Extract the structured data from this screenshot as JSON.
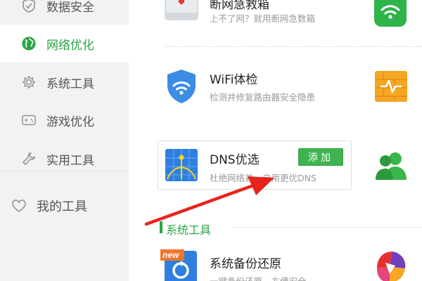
{
  "sidebar": {
    "items": [
      {
        "label": "数据安全",
        "icon": "shield-icon"
      },
      {
        "label": "网络优化",
        "icon": "globe-icon",
        "active": true
      },
      {
        "label": "系统工具",
        "icon": "gear-icon"
      },
      {
        "label": "游戏优化",
        "icon": "gamepad-icon"
      },
      {
        "label": "实用工具",
        "icon": "wrench-icon"
      }
    ],
    "my_tools": {
      "label": "我的工具",
      "icon": "heart-icon"
    }
  },
  "tools": {
    "emergency": {
      "title": "断网急救箱",
      "desc": "上不了网？就用断网急数箱"
    },
    "wifi": {
      "title": "WiFi体检",
      "desc": "检测并修复路由器安全隐患"
    },
    "dns": {
      "title": "DNS优选",
      "desc": "杜绝网络差，启用更优DNS",
      "add_label": "添加"
    },
    "backup": {
      "title": "系统备份还原",
      "desc": "一键备份还原，方便安全",
      "badge": "new"
    }
  },
  "sections": {
    "system_tools": "系统工具"
  },
  "colors": {
    "accent_green": "#2aa545",
    "button_green": "#3fb34f",
    "annotation_red": "#e8231d"
  }
}
